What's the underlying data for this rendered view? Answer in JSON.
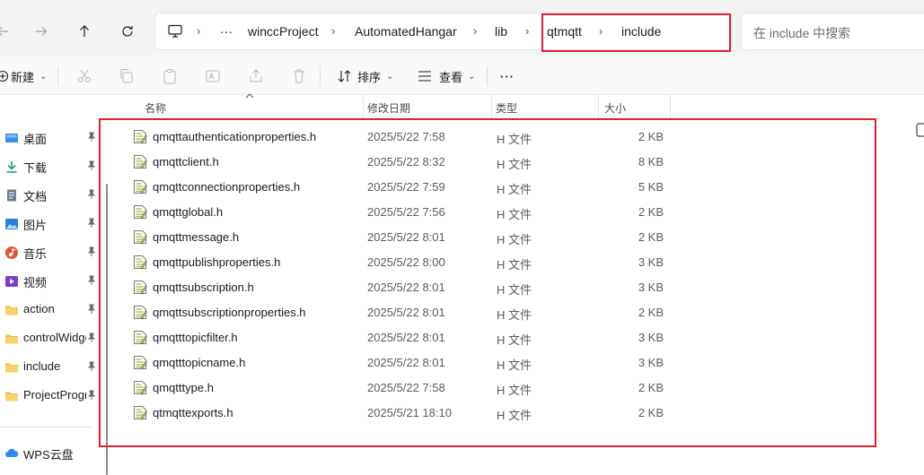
{
  "breadcrumbs": [
    "winccProject",
    "AutomatedHangar",
    "lib",
    "qtmqtt",
    "include"
  ],
  "breadcrumb_more": "···",
  "search": {
    "placeholder": "在 include 中搜索"
  },
  "toolbar": {
    "new_label": "新建",
    "sort_label": "排序",
    "view_label": "查看",
    "more_label": "···"
  },
  "sidebar": {
    "items": [
      {
        "label": "桌面",
        "icon": "desktop-icon",
        "pinned": true
      },
      {
        "label": "下载",
        "icon": "download-icon",
        "pinned": true
      },
      {
        "label": "文档",
        "icon": "document-icon",
        "pinned": true
      },
      {
        "label": "图片",
        "icon": "picture-icon",
        "pinned": true
      },
      {
        "label": "音乐",
        "icon": "music-icon",
        "pinned": true
      },
      {
        "label": "视频",
        "icon": "video-icon",
        "pinned": true
      },
      {
        "label": "action",
        "icon": "folder-icon",
        "pinned": true
      },
      {
        "label": "controlWidget",
        "icon": "folder-icon",
        "pinned": true
      },
      {
        "label": "include",
        "icon": "folder-icon",
        "pinned": true
      },
      {
        "label": "ProjectProgram",
        "icon": "folder-icon",
        "pinned": true
      }
    ],
    "wps": {
      "label": "WPS云盘",
      "icon": "cloud-icon"
    }
  },
  "columns": {
    "name": "名称",
    "date": "修改日期",
    "type": "类型",
    "size": "大小"
  },
  "files": [
    {
      "name": "qmqttauthenticationproperties.h",
      "date": "2025/5/22 7:58",
      "type": "H 文件",
      "size": "2 KB"
    },
    {
      "name": "qmqttclient.h",
      "date": "2025/5/22 8:32",
      "type": "H 文件",
      "size": "8 KB"
    },
    {
      "name": "qmqttconnectionproperties.h",
      "date": "2025/5/22 7:59",
      "type": "H 文件",
      "size": "5 KB"
    },
    {
      "name": "qmqttglobal.h",
      "date": "2025/5/22 7:56",
      "type": "H 文件",
      "size": "2 KB"
    },
    {
      "name": "qmqttmessage.h",
      "date": "2025/5/22 8:01",
      "type": "H 文件",
      "size": "2 KB"
    },
    {
      "name": "qmqttpublishproperties.h",
      "date": "2025/5/22 8:00",
      "type": "H 文件",
      "size": "3 KB"
    },
    {
      "name": "qmqttsubscription.h",
      "date": "2025/5/22 8:01",
      "type": "H 文件",
      "size": "3 KB"
    },
    {
      "name": "qmqttsubscriptionproperties.h",
      "date": "2025/5/22 8:01",
      "type": "H 文件",
      "size": "2 KB"
    },
    {
      "name": "qmqtttopicfilter.h",
      "date": "2025/5/22 8:01",
      "type": "H 文件",
      "size": "3 KB"
    },
    {
      "name": "qmqtttopicname.h",
      "date": "2025/5/22 8:01",
      "type": "H 文件",
      "size": "3 KB"
    },
    {
      "name": "qmqtttype.h",
      "date": "2025/5/22 7:58",
      "type": "H 文件",
      "size": "2 KB"
    },
    {
      "name": "qtmqttexports.h",
      "date": "2025/5/21 18:10",
      "type": "H 文件",
      "size": "2 KB"
    }
  ],
  "colors": {
    "highlight": "#e0202a",
    "folder": "#f0c14b",
    "accent": "#0067c0"
  }
}
